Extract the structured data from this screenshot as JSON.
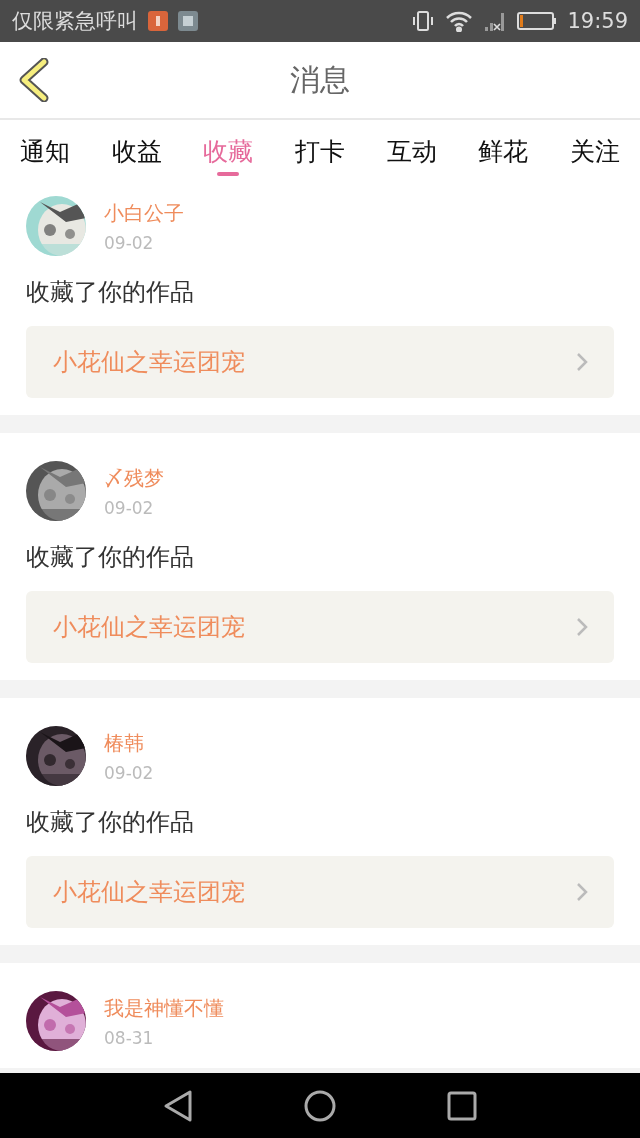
{
  "status_bar": {
    "notice": "仅限紧急呼叫",
    "time": "19:59"
  },
  "header": {
    "title": "消息"
  },
  "tabs": [
    {
      "label": "通知",
      "selected": false
    },
    {
      "label": "收益",
      "selected": false
    },
    {
      "label": "收藏",
      "selected": true
    },
    {
      "label": "打卡",
      "selected": false
    },
    {
      "label": "互动",
      "selected": false
    },
    {
      "label": "鲜花",
      "selected": false
    },
    {
      "label": "关注",
      "selected": false
    }
  ],
  "messages": [
    {
      "user": "小白公子",
      "date": "09-02",
      "action": "收藏了你的作品",
      "work_title": "小花仙之幸运团宠"
    },
    {
      "user": "〆残梦",
      "date": "09-02",
      "action": "收藏了你的作品",
      "work_title": "小花仙之幸运团宠"
    },
    {
      "user": "椿韩",
      "date": "09-02",
      "action": "收藏了你的作品",
      "work_title": "小花仙之幸运团宠"
    },
    {
      "user": "我是神懂不懂",
      "date": "08-31"
    }
  ]
}
